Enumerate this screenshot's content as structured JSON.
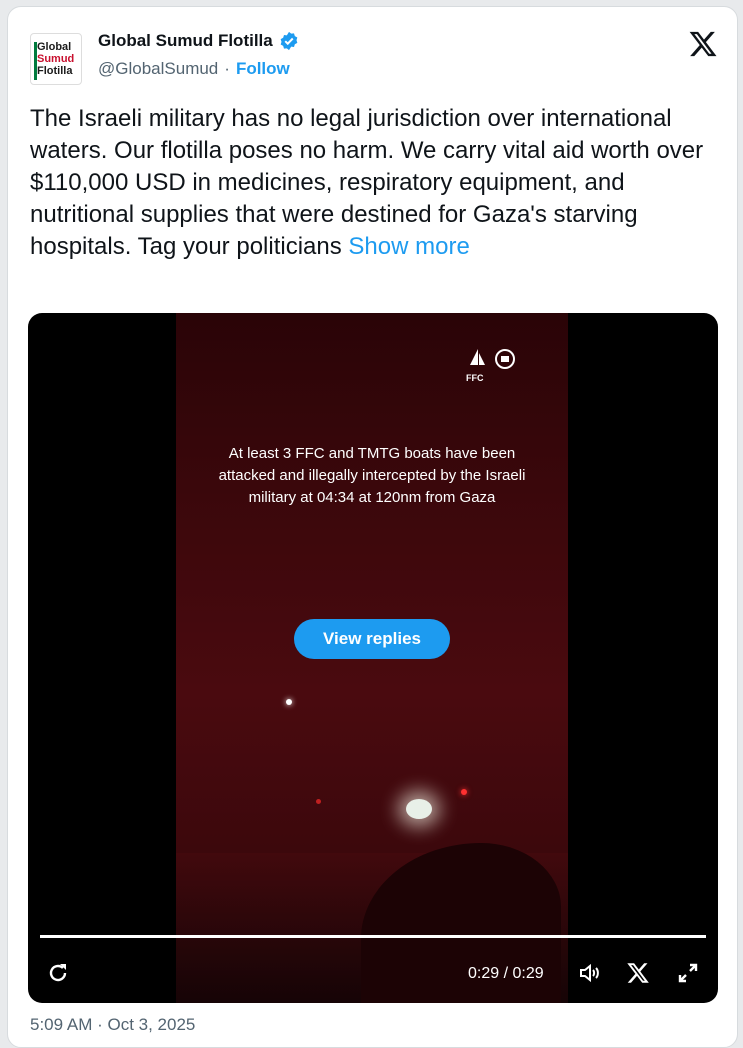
{
  "account": {
    "avatar_lines": [
      "Global",
      "Sumud",
      "Flotilla"
    ],
    "name": "Global Sumud Flotilla",
    "handle": "@GlobalSumud",
    "separator": "·",
    "follow_label": "Follow"
  },
  "tweet": {
    "text": "The Israeli military has no legal jurisdiction over international waters. Our flotilla poses no harm. We carry vital aid worth over $110,000 USD in medicines, respiratory equipment, and nutritional supplies that were destined for Gaza's starving hospitals. Tag your politicians",
    "show_more": "Show more"
  },
  "video": {
    "logo_text": "FFC",
    "overlay_text": "At least 3 FFC and TMTG boats have been attacked and illegally intercepted by the Israeli military at 04:34 at 120nm from Gaza",
    "view_replies_label": "View replies",
    "time": "0:29 / 0:29",
    "progress": 1.0
  },
  "footer": {
    "timestamp": "5:09 AM · Oct 3, 2025"
  },
  "colors": {
    "accent": "#1d9bf0",
    "text": "#0f1419",
    "muted": "#536471"
  }
}
